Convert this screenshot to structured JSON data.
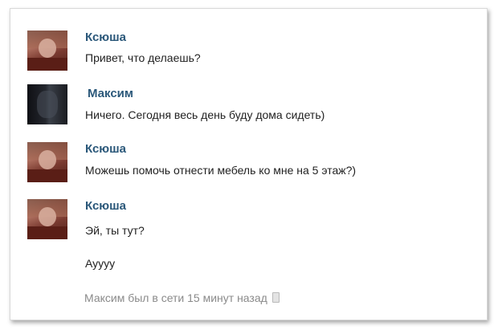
{
  "messages": [
    {
      "sender": "Ксюша",
      "lines": [
        "Привет, что делаешь?"
      ]
    },
    {
      "sender": "Максим",
      "lines": [
        "Ничего. Сегодня весь день буду дома сидеть)"
      ]
    },
    {
      "sender": "Ксюша",
      "lines": [
        "Можешь помочь отнести мебель ко мне на 5 этаж?)"
      ]
    },
    {
      "sender": "Ксюша",
      "lines": [
        "Эй, ты тут?",
        "Ауууу"
      ]
    }
  ],
  "status": {
    "text": "Максим был в сети 15 минут назад",
    "icon": "mobile-phone-icon"
  },
  "colors": {
    "name": "#2b587a",
    "text": "#222222",
    "status": "#8a8a8a"
  }
}
